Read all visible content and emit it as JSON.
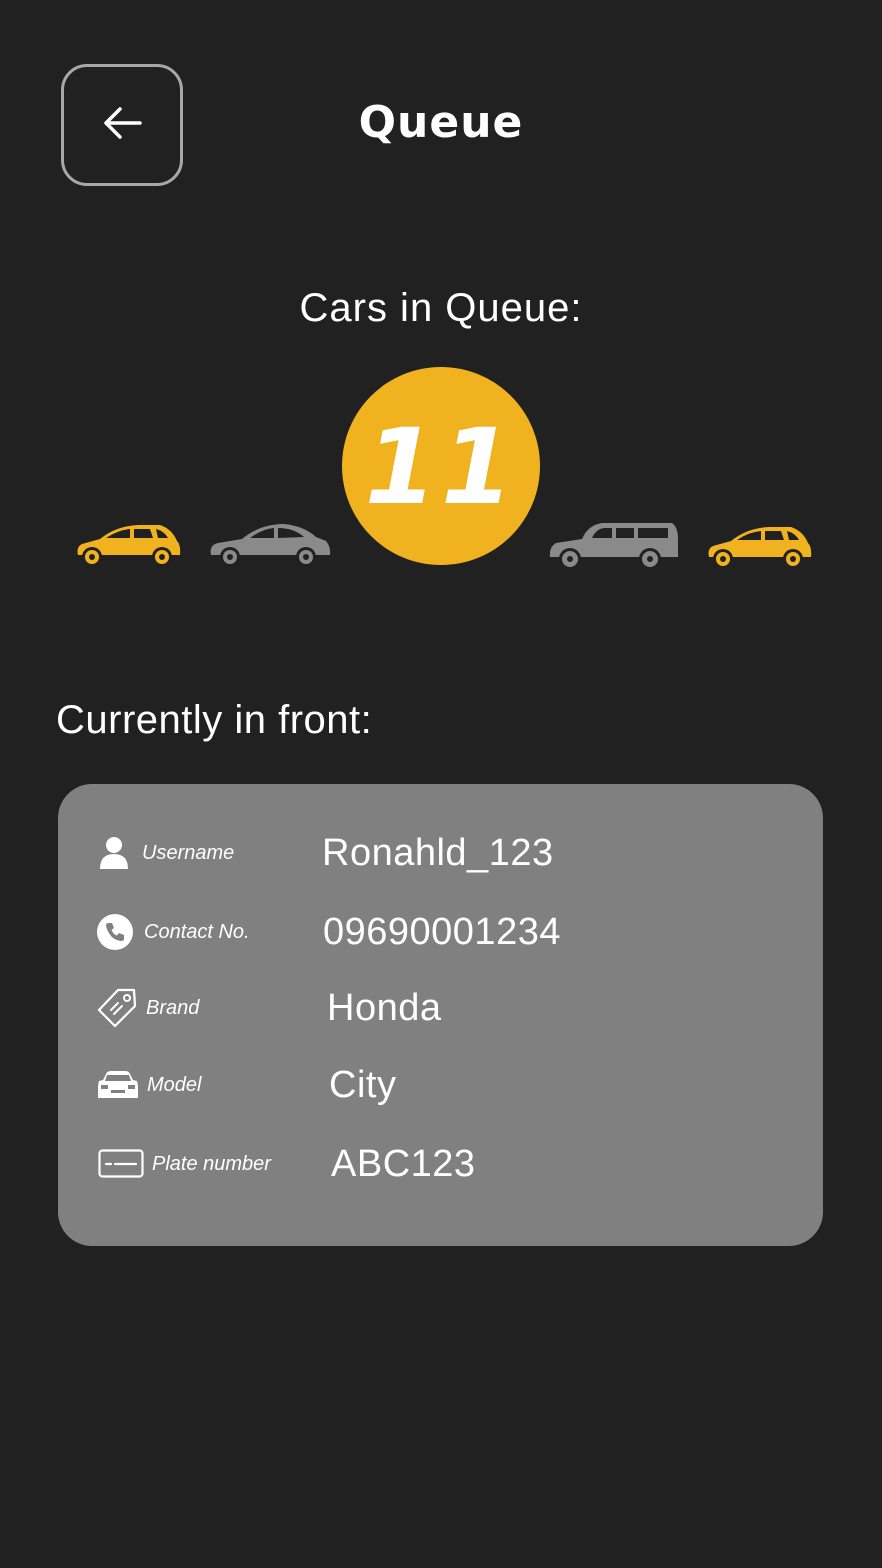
{
  "header": {
    "title": "Queue",
    "back_icon": "arrow-left-icon"
  },
  "queue": {
    "label": "Cars in Queue:",
    "count": "11",
    "cars": [
      {
        "icon": "hatchback-car-icon",
        "color": "#f0b21f"
      },
      {
        "icon": "sedan-car-icon",
        "color": "#8a8a8a"
      },
      {
        "icon": "suv-car-icon",
        "color": "#8a8a8a"
      },
      {
        "icon": "hatchback-car-icon",
        "color": "#f0b21f"
      }
    ]
  },
  "front": {
    "title": "Currently in front:",
    "rows": [
      {
        "icon": "user-icon",
        "label": "Username",
        "value": "Ronahld_123"
      },
      {
        "icon": "phone-icon",
        "label": "Contact No.",
        "value": "09690001234"
      },
      {
        "icon": "tag-icon",
        "label": "Brand",
        "value": "Honda"
      },
      {
        "icon": "car-front-icon",
        "label": "Model",
        "value": "City"
      },
      {
        "icon": "plate-icon",
        "label": "Plate number",
        "value": "ABC123"
      }
    ]
  },
  "colors": {
    "background": "#212121",
    "accent": "#f0b21f",
    "card": "#808080",
    "muted_car": "#8a8a8a",
    "back_border": "#a8a8a8"
  }
}
